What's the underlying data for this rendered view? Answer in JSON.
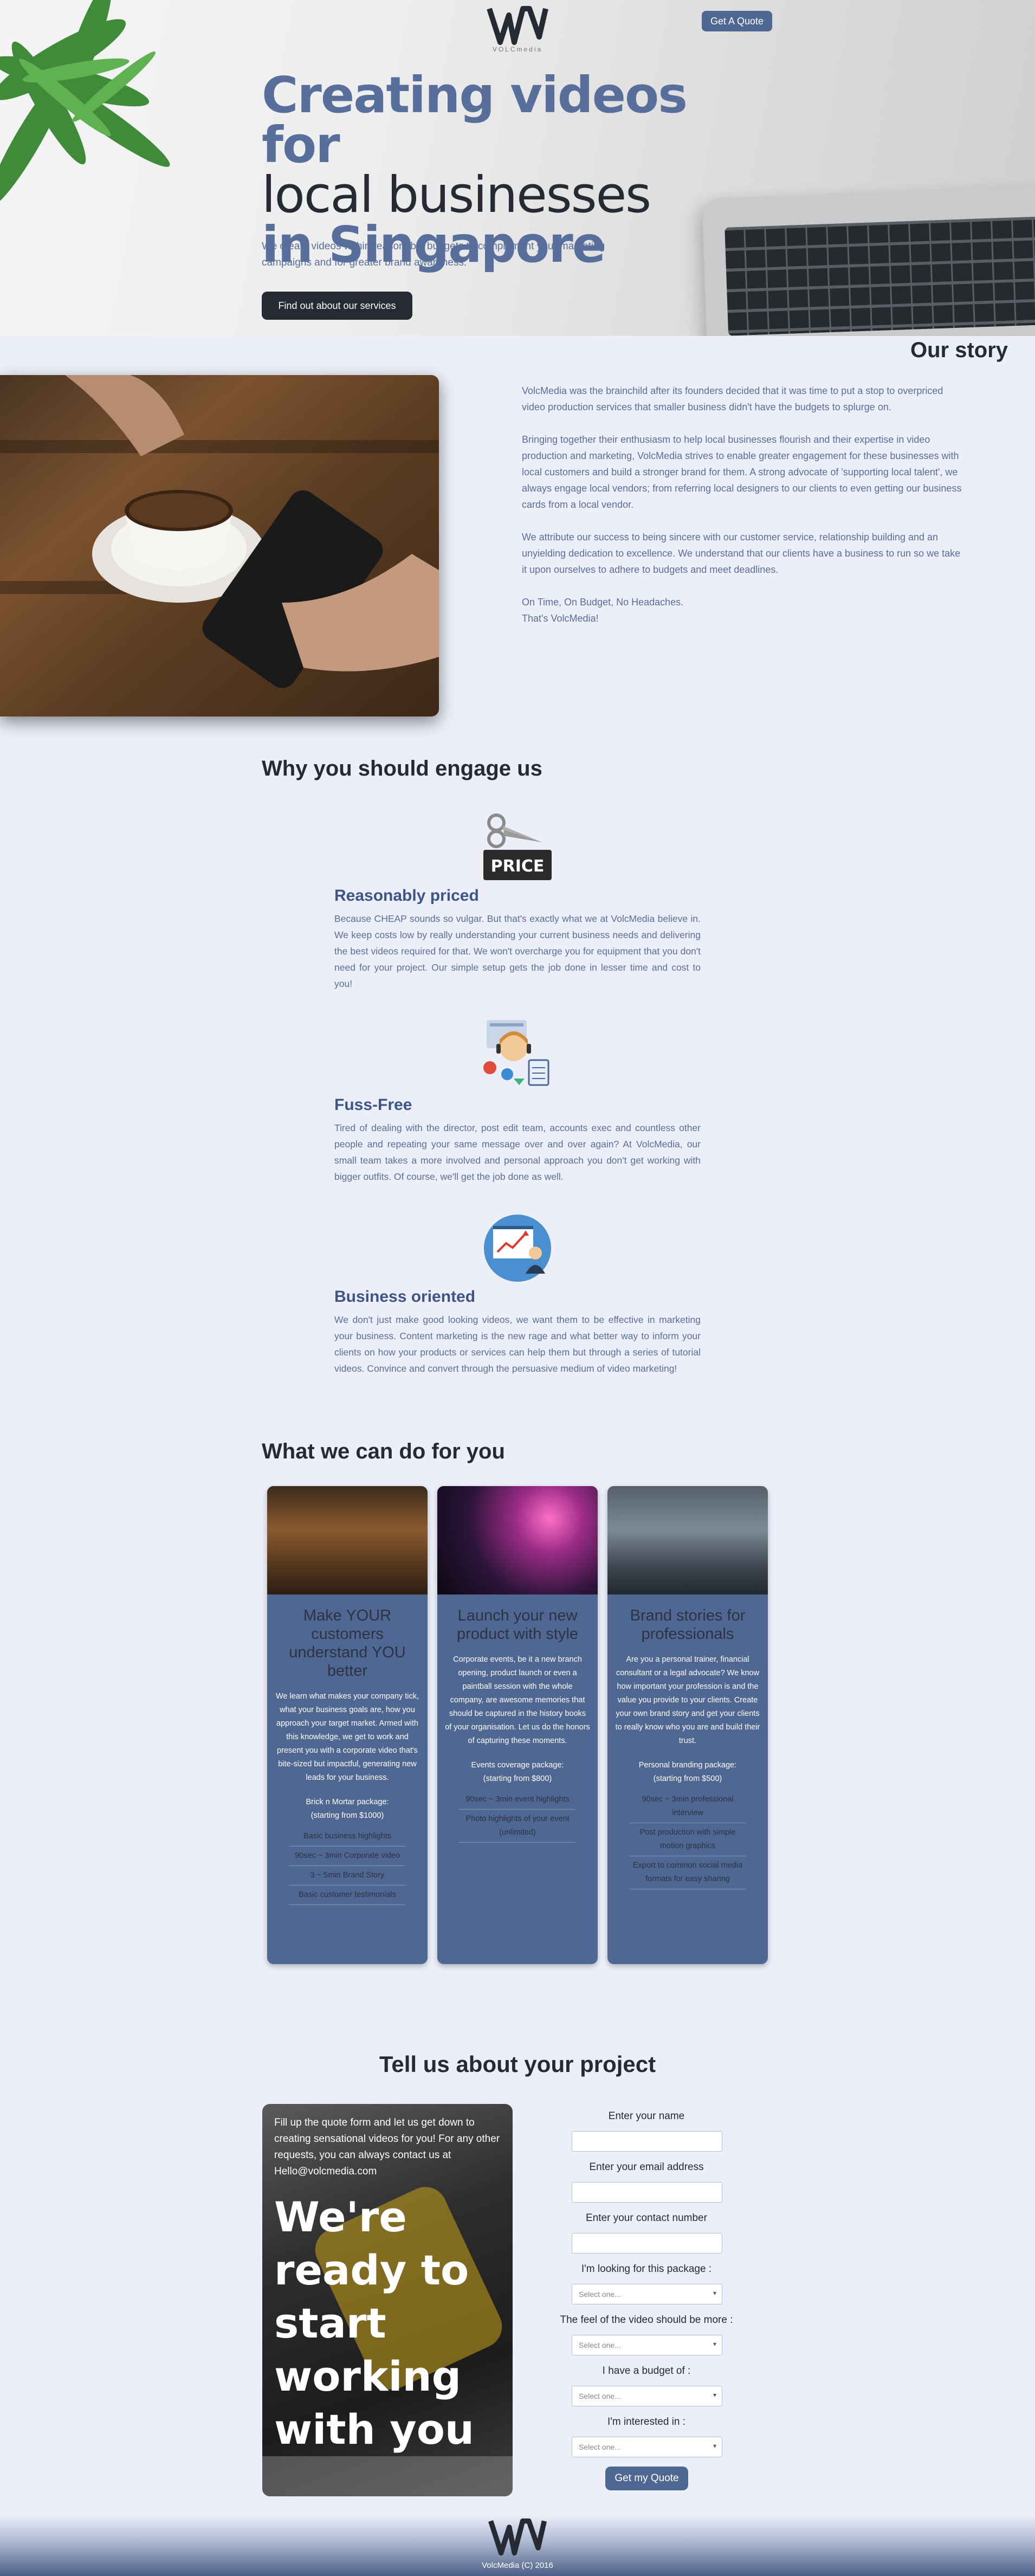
{
  "header": {
    "logo_text": "VOLCmedia",
    "quote_button": "Get A Quote"
  },
  "hero": {
    "title_line1": "Creating videos for",
    "title_line2": "local businesses",
    "title_line3": "in Singapore",
    "subtitle": "We create videos within reasonable budgets to complement your marketing campaigns and for greater brand awareness.",
    "cta": "Find out about our services"
  },
  "story": {
    "title": "Our story",
    "p1": "VolcMedia was the brainchild after its founders decided that it was time to put a stop to overpriced video production services that smaller business didn't have the budgets to splurge on.",
    "p2": "Bringing together their enthusiasm to help local businesses flourish and their expertise in video production and marketing, VolcMedia strives to enable greater engagement for these businesses with local customers and build a stronger brand for them. A strong advocate of 'supporting local talent', we always engage local vendors; from referring local designers to our clients to even getting our business cards from a local vendor.",
    "p3": "We attribute our success to being sincere with our customer service, relationship building and an unyielding dedication to excellence. We understand that our clients have a business to run so we take it upon ourselves to adhere to budgets and meet deadlines.",
    "p4a": "On Time, On Budget, No Headaches.",
    "p4b": "That's VolcMedia!"
  },
  "why": {
    "title": "Why you should engage us",
    "price_badge": "PRICE",
    "features": [
      {
        "title": "Reasonably priced",
        "text": "Because CHEAP sounds so vulgar. But that's exactly what we at VolcMedia believe in. We keep costs low by really understanding your current business needs and delivering the best videos required for that. We won't overcharge you for equipment that you don't need for your project. Our simple setup gets the job done in lesser time and cost to you!"
      },
      {
        "title": "Fuss-Free",
        "text": "Tired of dealing with the director, post edit team, accounts exec and countless other people and repeating your same message over and over again? At VolcMedia, our small team takes a more involved and personal approach you don't get working with bigger outfits. Of course, we'll get the job done as well."
      },
      {
        "title": "Business oriented",
        "text": "We don't just make good looking videos, we want them to be effective in marketing your business. Content marketing is the new rage and what better way to inform your clients on how your products or services can help them but through a series of tutorial videos. Convince and convert through the persuasive medium of video marketing!"
      }
    ]
  },
  "services": {
    "title": "What we can do for you",
    "cards": [
      {
        "title": "Make YOUR customers understand YOU better",
        "desc": "We learn what makes your company tick, what your business goals are, how you approach your target market. Armed with this knowledge, we get to work and present you with a corporate video that's bite-sized but impactful, generating new leads for your business.",
        "pkg_name": "Brick n Mortar package:",
        "pkg_price": "(starting from $1000)",
        "items": [
          "Basic business highlights",
          "90sec ~ 3min Corporate video",
          "3 ~ 5min Brand Story",
          "Basic customer testimonials"
        ]
      },
      {
        "title": "Launch your new product with style",
        "desc": "Corporate events, be it a new branch opening, product launch or even a paintball session with the whole company, are awesome memories that should be captured in the history books of your organisation. Let us do the honors of capturing these moments.",
        "pkg_name": "Events coverage package:",
        "pkg_price": "(starting from $800)",
        "items": [
          "90sec ~ 3min event highlights",
          "Photo highlights of your event (unlimited)"
        ]
      },
      {
        "title": "Brand stories for professionals",
        "desc": "Are you a personal trainer, financial consultant or a legal advocate? We know how important your profession is and the value you provide to your clients. Create your own brand story and get your clients to really know who you are and build their trust.",
        "pkg_name": "Personal branding package:",
        "pkg_price": "(starting from $500)",
        "items": [
          "90sec ~ 3min professional interview",
          "Post production with simple motion graphics",
          "Export to common social media formats for easy sharing"
        ]
      }
    ]
  },
  "contact": {
    "title": "Tell us about your project",
    "intro": "Fill up the quote form and let us get down to creating sensational videos for you! For any other requests, you can always contact us at Hello@volcmedia.com",
    "big_line1": "We're",
    "big_line2": "ready to",
    "big_line3": "start",
    "big_line4": "working",
    "big_line5": "with you",
    "name_label": "Enter your name",
    "email_label": "Enter your email address",
    "phone_label": "Enter your contact number",
    "package_label": "I'm looking for this package :",
    "feel_label": "The feel of the video should be more :",
    "budget_label": "I have a budget of :",
    "interest_label": "I'm interested in :",
    "select_placeholder": "Select one...",
    "submit": "Get my Quote"
  },
  "footer": {
    "copyright": "VolcMedia (C) 2016"
  },
  "colors": {
    "accent": "#4f6793",
    "title_blue": "#596f9b",
    "dark": "#262a33",
    "background": "#eceef8"
  }
}
